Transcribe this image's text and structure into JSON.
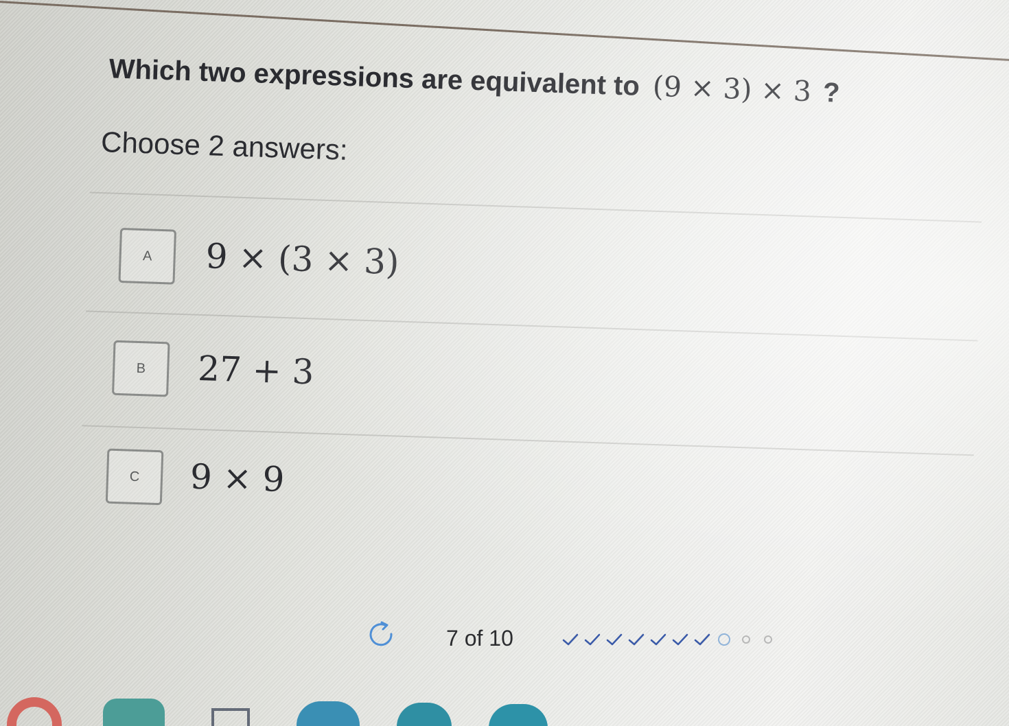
{
  "question": {
    "prompt": "Which two expressions are equivalent to",
    "expression": "(9 × 3) × 3",
    "qmark": "?"
  },
  "instruction": "Choose 2 answers:",
  "choices": [
    {
      "letter": "A",
      "expression": "9 × (3 × 3)"
    },
    {
      "letter": "B",
      "expression": "27 + 3"
    },
    {
      "letter": "C",
      "expression": "9 × 9"
    }
  ],
  "progress": {
    "text": "7 of 10",
    "current": 7,
    "total": 10,
    "completed": 7,
    "states": [
      "done",
      "done",
      "done",
      "done",
      "done",
      "done",
      "done",
      "current",
      "pending",
      "pending"
    ]
  },
  "colors": {
    "text": "#2a2b30",
    "check": "#3a5aa8",
    "current": "#8fb3d9",
    "pending": "#b8b8b8"
  },
  "icons": [
    "refresh-icon",
    "check-icon"
  ]
}
